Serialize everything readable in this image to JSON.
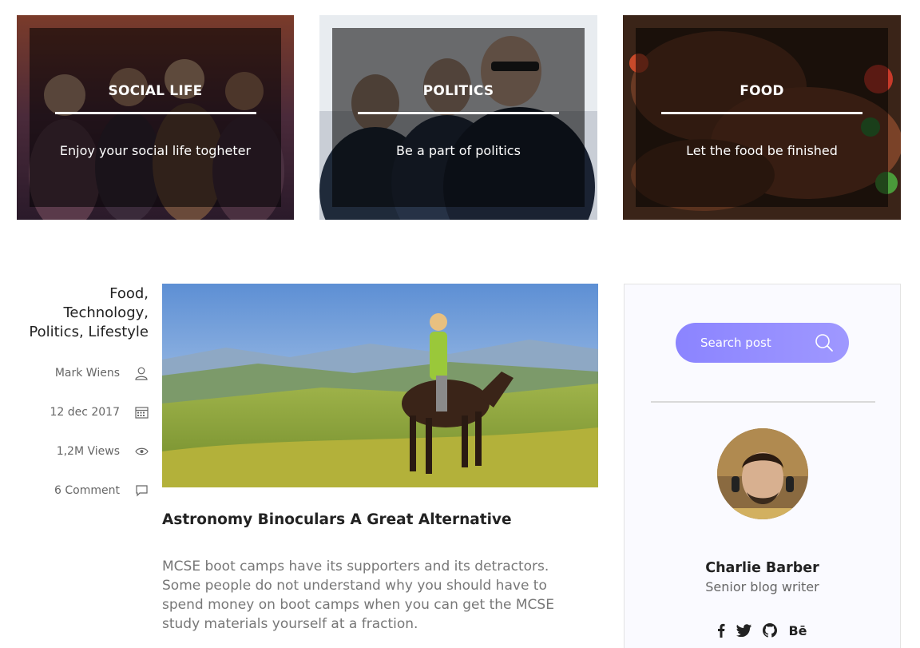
{
  "categories": [
    {
      "title": "SOCIAL LIFE",
      "subtitle": "Enjoy your social life togheter"
    },
    {
      "title": "POLITICS",
      "subtitle": "Be a part of politics"
    },
    {
      "title": "FOOD",
      "subtitle": "Let the food be finished"
    }
  ],
  "post": {
    "categories_line1": "Food,",
    "categories_line2": "Technology,",
    "categories_line3": "Politics, Lifestyle",
    "author": "Mark Wiens",
    "date": "12 dec 2017",
    "views": "1,2M Views",
    "comments": "6 Comment",
    "title": "Astronomy Binoculars A Great Alternative",
    "excerpt": "MCSE boot camps have its supporters and its detractors. Some people do not understand why you should have to spend money on boot camps when you can get the MCSE study materials yourself at a fraction."
  },
  "sidebar": {
    "search_placeholder": "Search post",
    "author_name": "Charlie Barber",
    "author_role": "Senior blog writer",
    "behance_label": "Bē"
  },
  "icons": {
    "author": "user-icon",
    "date": "calendar-icon",
    "views": "eye-icon",
    "comments": "comment-icon",
    "search": "search-icon",
    "social": [
      "facebook-icon",
      "twitter-icon",
      "github-icon",
      "behance-icon"
    ]
  },
  "colors": {
    "accent": "#8b84ff",
    "overlay": "#000000"
  }
}
